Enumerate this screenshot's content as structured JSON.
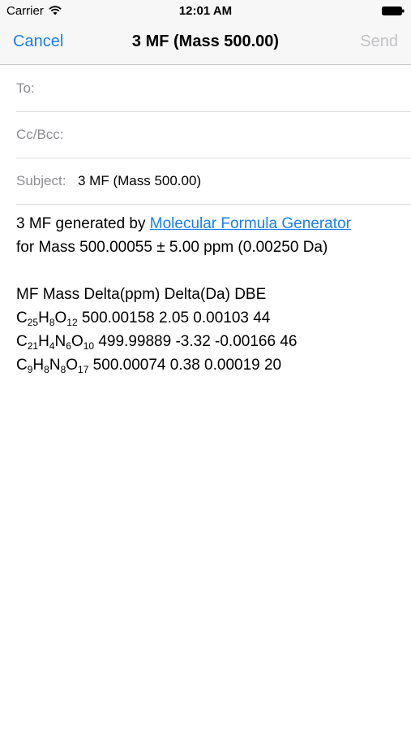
{
  "status": {
    "carrier": "Carrier",
    "time": "12:01 AM"
  },
  "nav": {
    "cancel": "Cancel",
    "title": "3 MF (Mass 500.00)",
    "send": "Send"
  },
  "fields": {
    "to_label": "To:",
    "cc_label": "Cc/Bcc:",
    "subject_label": "Subject:",
    "subject_value": "3 MF (Mass 500.00)"
  },
  "body": {
    "intro_prefix": "3 MF generated by ",
    "link_text": "Molecular Formula Generator",
    "mass_line": "for Mass 500.00055 ± 5.00 ppm (0.00250 Da)",
    "header_line": "MF Mass Delta(ppm) Delta(Da) DBE",
    "rows": [
      {
        "formula": [
          [
            "C",
            "25"
          ],
          [
            "H",
            "8"
          ],
          [
            "O",
            "12"
          ]
        ],
        "mass": "500.00158",
        "delta_ppm": "2.05",
        "delta_da": "0.00103",
        "dbe": "44"
      },
      {
        "formula": [
          [
            "C",
            "21"
          ],
          [
            "H",
            "4"
          ],
          [
            "N",
            "6"
          ],
          [
            "O",
            "10"
          ]
        ],
        "mass": "499.99889",
        "delta_ppm": "-3.32",
        "delta_da": "-0.00166",
        "dbe": "46"
      },
      {
        "formula": [
          [
            "C",
            "9"
          ],
          [
            "H",
            "8"
          ],
          [
            "N",
            "8"
          ],
          [
            "O",
            "17"
          ]
        ],
        "mass": "500.00074",
        "delta_ppm": "0.38",
        "delta_da": "0.00019",
        "dbe": "20"
      }
    ]
  },
  "colors": {
    "accent": "#1a7ff0",
    "disabled": "#c2c2c6",
    "label": "#8e8e93"
  },
  "icons": {
    "wifi": "wifi-icon",
    "battery": "battery-icon"
  }
}
